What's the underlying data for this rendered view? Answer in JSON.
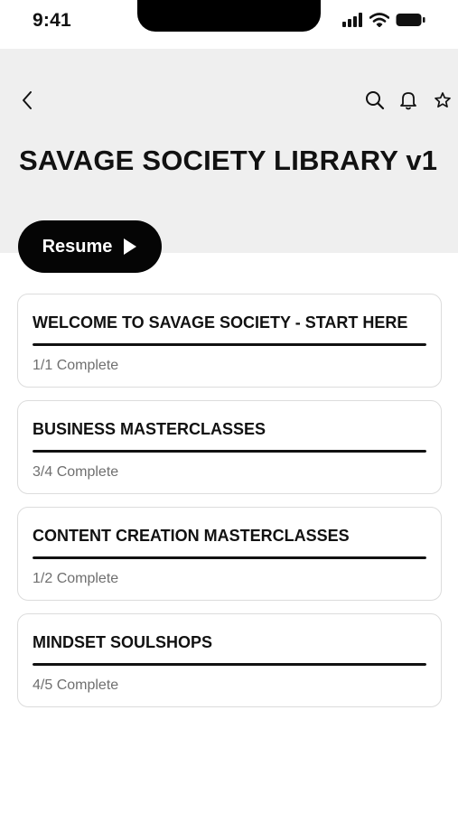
{
  "status_bar": {
    "time": "9:41"
  },
  "nav": {
    "back_icon": "chevron-left-icon",
    "search_icon": "search-icon",
    "bell_icon": "bell-icon",
    "star_icon": "star-icon"
  },
  "page": {
    "title": "SAVAGE SOCIETY LIBRARY v1"
  },
  "resume": {
    "label": "Resume",
    "icon": "play-icon"
  },
  "colors": {
    "header_bg": "#efefef",
    "button_bg": "#050505",
    "progress": "#111111",
    "muted_text": "#6f6f6f"
  },
  "sections": [
    {
      "title": "WELCOME TO SAVAGE SOCIETY - START HERE",
      "status": "1/1 Complete",
      "progress": 1.0
    },
    {
      "title": "BUSINESS MASTERCLASSES",
      "status": "3/4 Complete",
      "progress": 1.0
    },
    {
      "title": "CONTENT CREATION MASTERCLASSES",
      "status": "1/2 Complete",
      "progress": 1.0
    },
    {
      "title": "MINDSET SOULSHOPS",
      "status": "4/5 Complete",
      "progress": 1.0
    }
  ]
}
